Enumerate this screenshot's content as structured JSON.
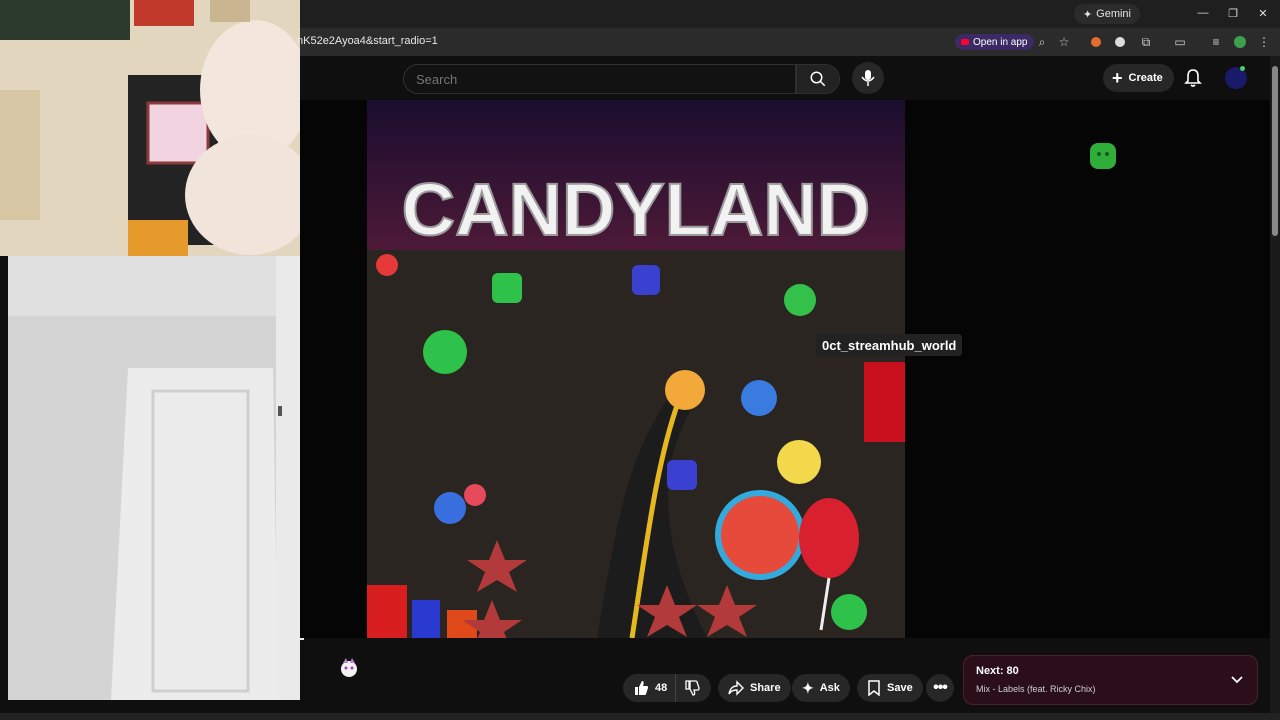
{
  "chrome": {
    "gemini_label": "Gemini",
    "url": "nK52e2Ayoa4&start_radio=1",
    "open_in_app_label": "Open in app"
  },
  "header": {
    "search_placeholder": "Search",
    "create_label": "Create"
  },
  "video": {
    "cover_title": "CANDYLAND",
    "tooltip_text": "0ct_streamhub_world"
  },
  "actions": {
    "like_count": "48",
    "share_label": "Share",
    "ask_label": "Ask",
    "save_label": "Save"
  },
  "next_card": {
    "title": "Next: 80",
    "subtitle": "Mix - Labels (feat. Ricky Chix)"
  },
  "colors": {
    "background": "#0f0f0f",
    "accent_red": "#ff0033",
    "next_card_bg": "#2a0f1a"
  }
}
